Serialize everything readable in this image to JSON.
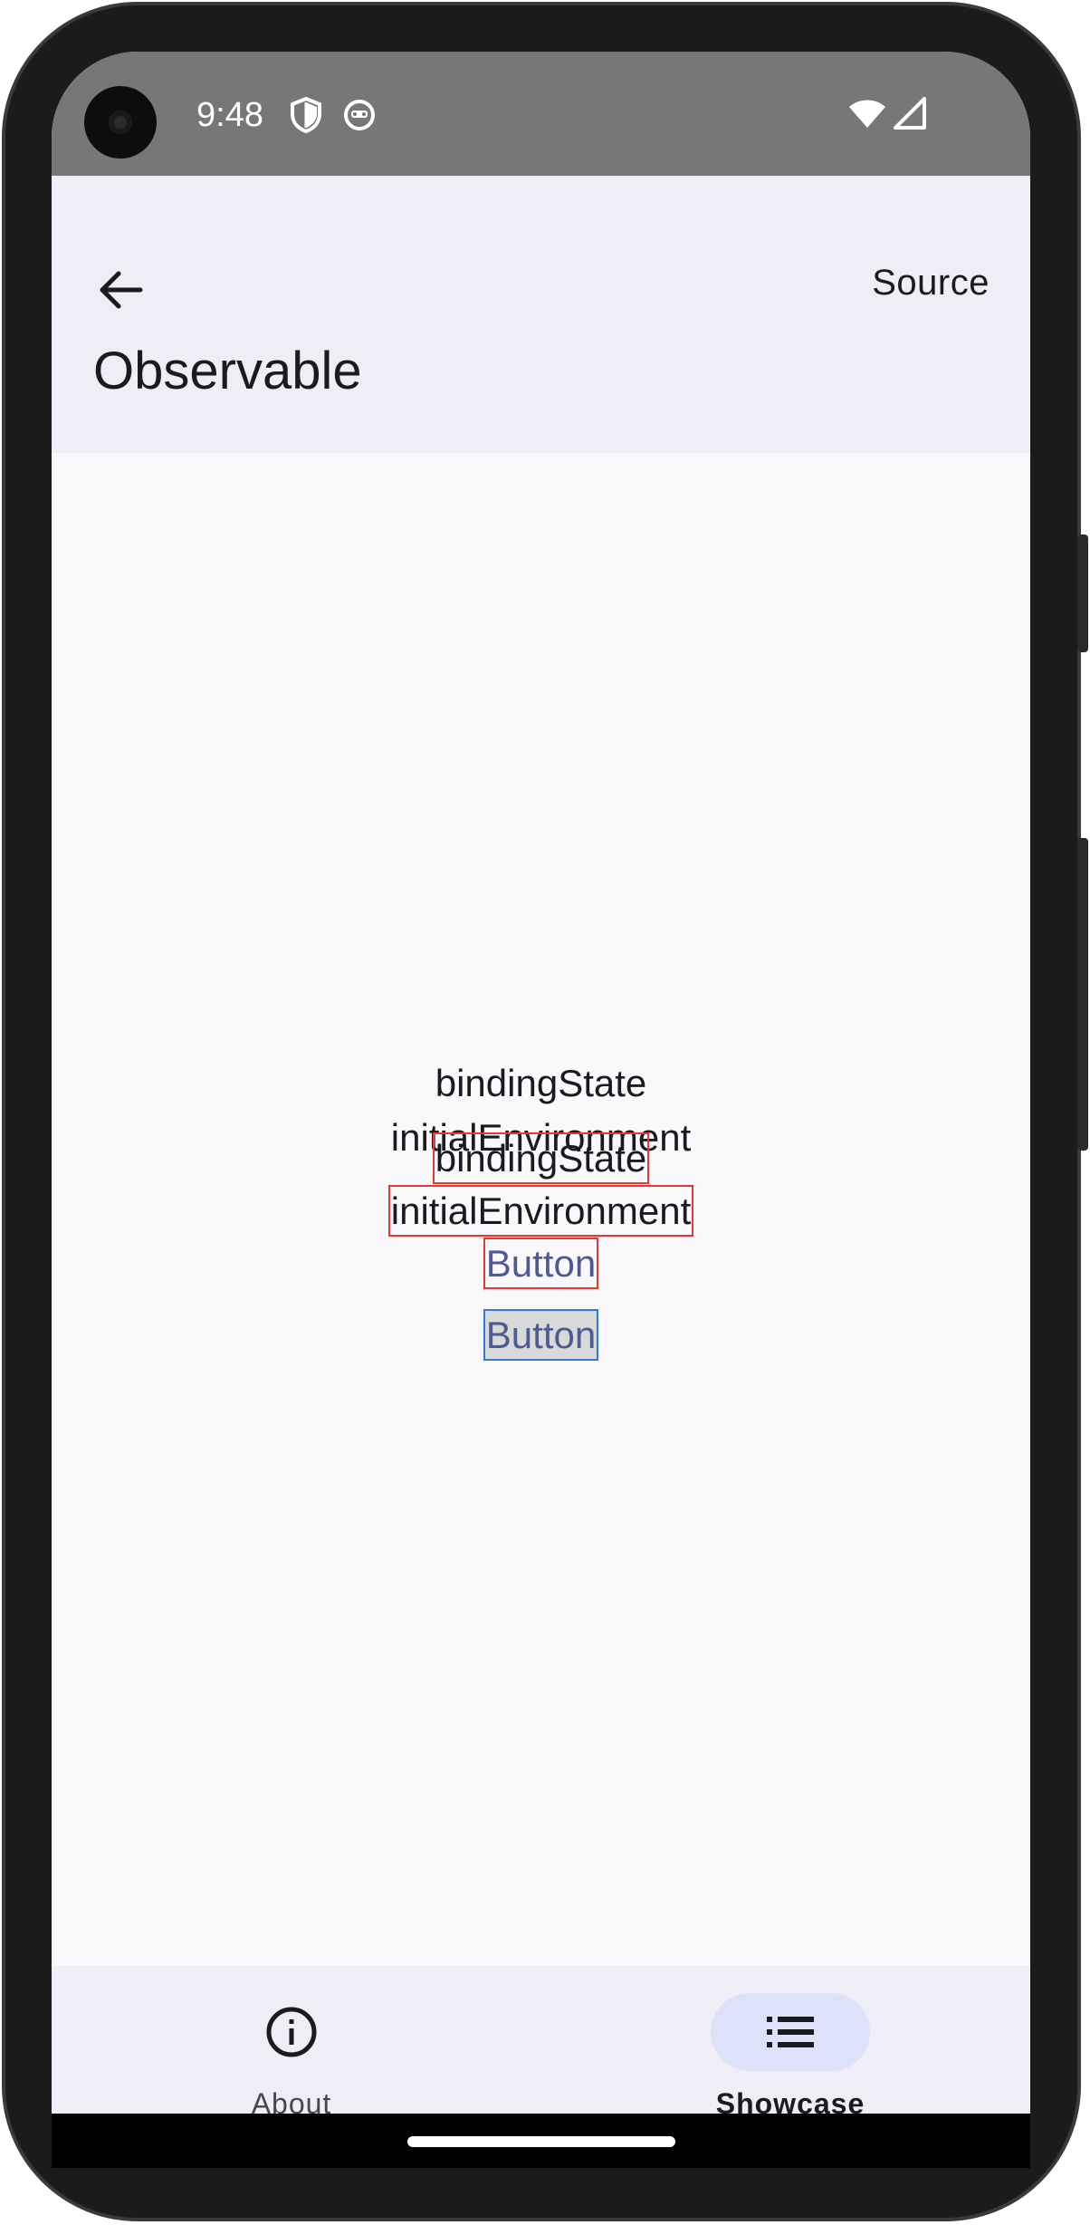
{
  "status_bar": {
    "time": "9:48",
    "icons": [
      "shield-icon",
      "cat-face-icon",
      "wifi-icon",
      "cellular-signal-icon"
    ]
  },
  "app_bar": {
    "back_icon": "arrow-left-icon",
    "action_label": "Source",
    "title": "Observable"
  },
  "content": {
    "plain_lines": [
      "bindingState",
      "initialEnvironment"
    ],
    "boxed_lines": [
      "bindingState",
      "initialEnvironment"
    ],
    "button_red": "Button",
    "button_blue": "Button"
  },
  "bottom_nav": {
    "items": [
      {
        "label": "About",
        "icon": "info-icon",
        "selected": false
      },
      {
        "label": "Showcase",
        "icon": "list-icon",
        "selected": true
      }
    ]
  },
  "colors": {
    "status_bar": "#777777",
    "app_bar": "#efedf6",
    "background": "#fbf8fc",
    "debug_red": "#e53935",
    "debug_blue": "#2f7ae0",
    "button_text": "#4d5b92",
    "nav_indicator": "#dde1f9"
  }
}
